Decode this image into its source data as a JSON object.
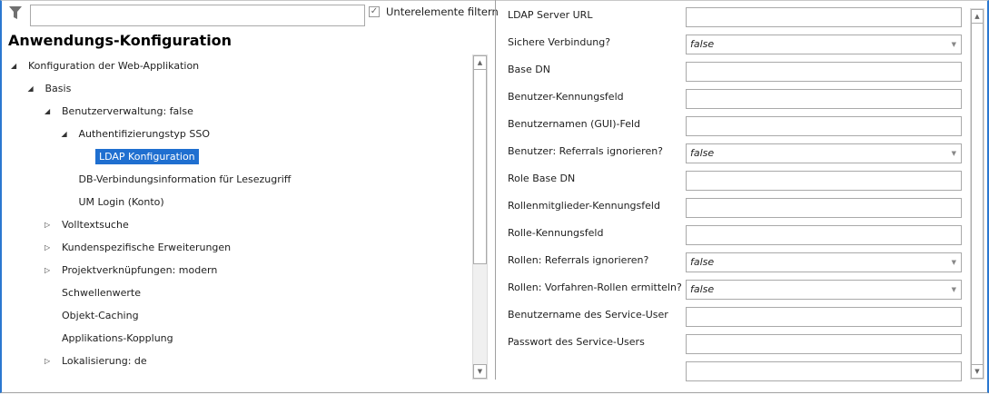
{
  "filter": {
    "value": "",
    "checkbox_label": "Unterelemente filtern",
    "checked": true
  },
  "title": "Anwendungs-Konfiguration",
  "tree": [
    {
      "label": "Konfiguration der Web-Applikation",
      "level": 0,
      "state": "expanded"
    },
    {
      "label": "Basis",
      "level": 1,
      "state": "expanded"
    },
    {
      "label": "Benutzerverwaltung: false",
      "level": 2,
      "state": "expanded"
    },
    {
      "label": "Authentifizierungstyp SSO",
      "level": 3,
      "state": "expanded"
    },
    {
      "label": "LDAP Konfiguration",
      "level": 4,
      "state": "leaf",
      "selected": true
    },
    {
      "label": "DB-Verbindungsinformation für Lesezugriff",
      "level": 3,
      "state": "leaf"
    },
    {
      "label": "UM Login (Konto)",
      "level": 3,
      "state": "leaf"
    },
    {
      "label": "Volltextsuche",
      "level": 2,
      "state": "collapsed"
    },
    {
      "label": "Kundenspezifische Erweiterungen",
      "level": 2,
      "state": "collapsed"
    },
    {
      "label": "Projektverknüpfungen: modern",
      "level": 2,
      "state": "collapsed"
    },
    {
      "label": "Schwellenwerte",
      "level": 2,
      "state": "leaf"
    },
    {
      "label": "Objekt-Caching",
      "level": 2,
      "state": "leaf"
    },
    {
      "label": "Applikations-Kopplung",
      "level": 2,
      "state": "leaf"
    },
    {
      "label": "Lokalisierung: de",
      "level": 2,
      "state": "collapsed"
    }
  ],
  "fields": [
    {
      "label": "LDAP Server URL",
      "type": "text",
      "value": ""
    },
    {
      "label": "Sichere Verbindung?",
      "type": "select",
      "value": "false"
    },
    {
      "label": "Base DN",
      "type": "text",
      "value": ""
    },
    {
      "label": "Benutzer-Kennungsfeld",
      "type": "text",
      "value": ""
    },
    {
      "label": "Benutzernamen (GUI)-Feld",
      "type": "text",
      "value": ""
    },
    {
      "label": "Benutzer: Referrals ignorieren?",
      "type": "select",
      "value": "false"
    },
    {
      "label": "Role Base DN",
      "type": "text",
      "value": ""
    },
    {
      "label": "Rollenmitglieder-Kennungsfeld",
      "type": "text",
      "value": ""
    },
    {
      "label": "Rolle-Kennungsfeld",
      "type": "text",
      "value": ""
    },
    {
      "label": "Rollen: Referrals ignorieren?",
      "type": "select",
      "value": "false"
    },
    {
      "label": "Rollen: Vorfahren-Rollen ermitteln?",
      "type": "select",
      "value": "false"
    },
    {
      "label": "Benutzername des Service-User",
      "type": "text",
      "value": ""
    },
    {
      "label": "Passwort des Service-Users",
      "type": "text",
      "value": ""
    },
    {
      "label": "",
      "type": "text",
      "value": ""
    }
  ]
}
